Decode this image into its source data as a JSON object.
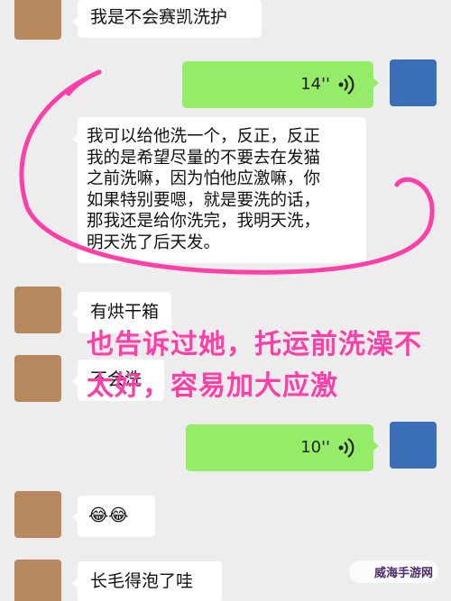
{
  "messages": [
    {
      "side": "in",
      "text": "我是不会赛凯洗护"
    },
    {
      "side": "out",
      "voice_duration": "14''"
    },
    {
      "side": "in",
      "text": "我可以给他洗一个，反正，反正\n我的是希望尽量的不要去在发猫\n之前洗嘛，因为怕他应激嘛，你\n如果特别要嗯，就是要洗的话，\n那我还是给你洗完，我明天洗，\n明天洗了后天发。"
    },
    {
      "side": "in",
      "text": "有烘干箱"
    },
    {
      "side": "in",
      "text": "不会洗"
    },
    {
      "side": "out",
      "voice_duration": "10''"
    },
    {
      "side": "in",
      "text": "😂😂"
    },
    {
      "side": "in",
      "text": "长毛得泡了哇"
    }
  ],
  "annotation": {
    "text": "也告诉过她，托运前洗澡不\n太好，容易加大应激",
    "color": "#ff3fa8"
  },
  "watermark": {
    "text": "威海手游网"
  },
  "colors": {
    "outgoing": "#95ec69",
    "incoming": "#ffffff",
    "background": "#ededed",
    "annotation": "#ff3fa8"
  }
}
